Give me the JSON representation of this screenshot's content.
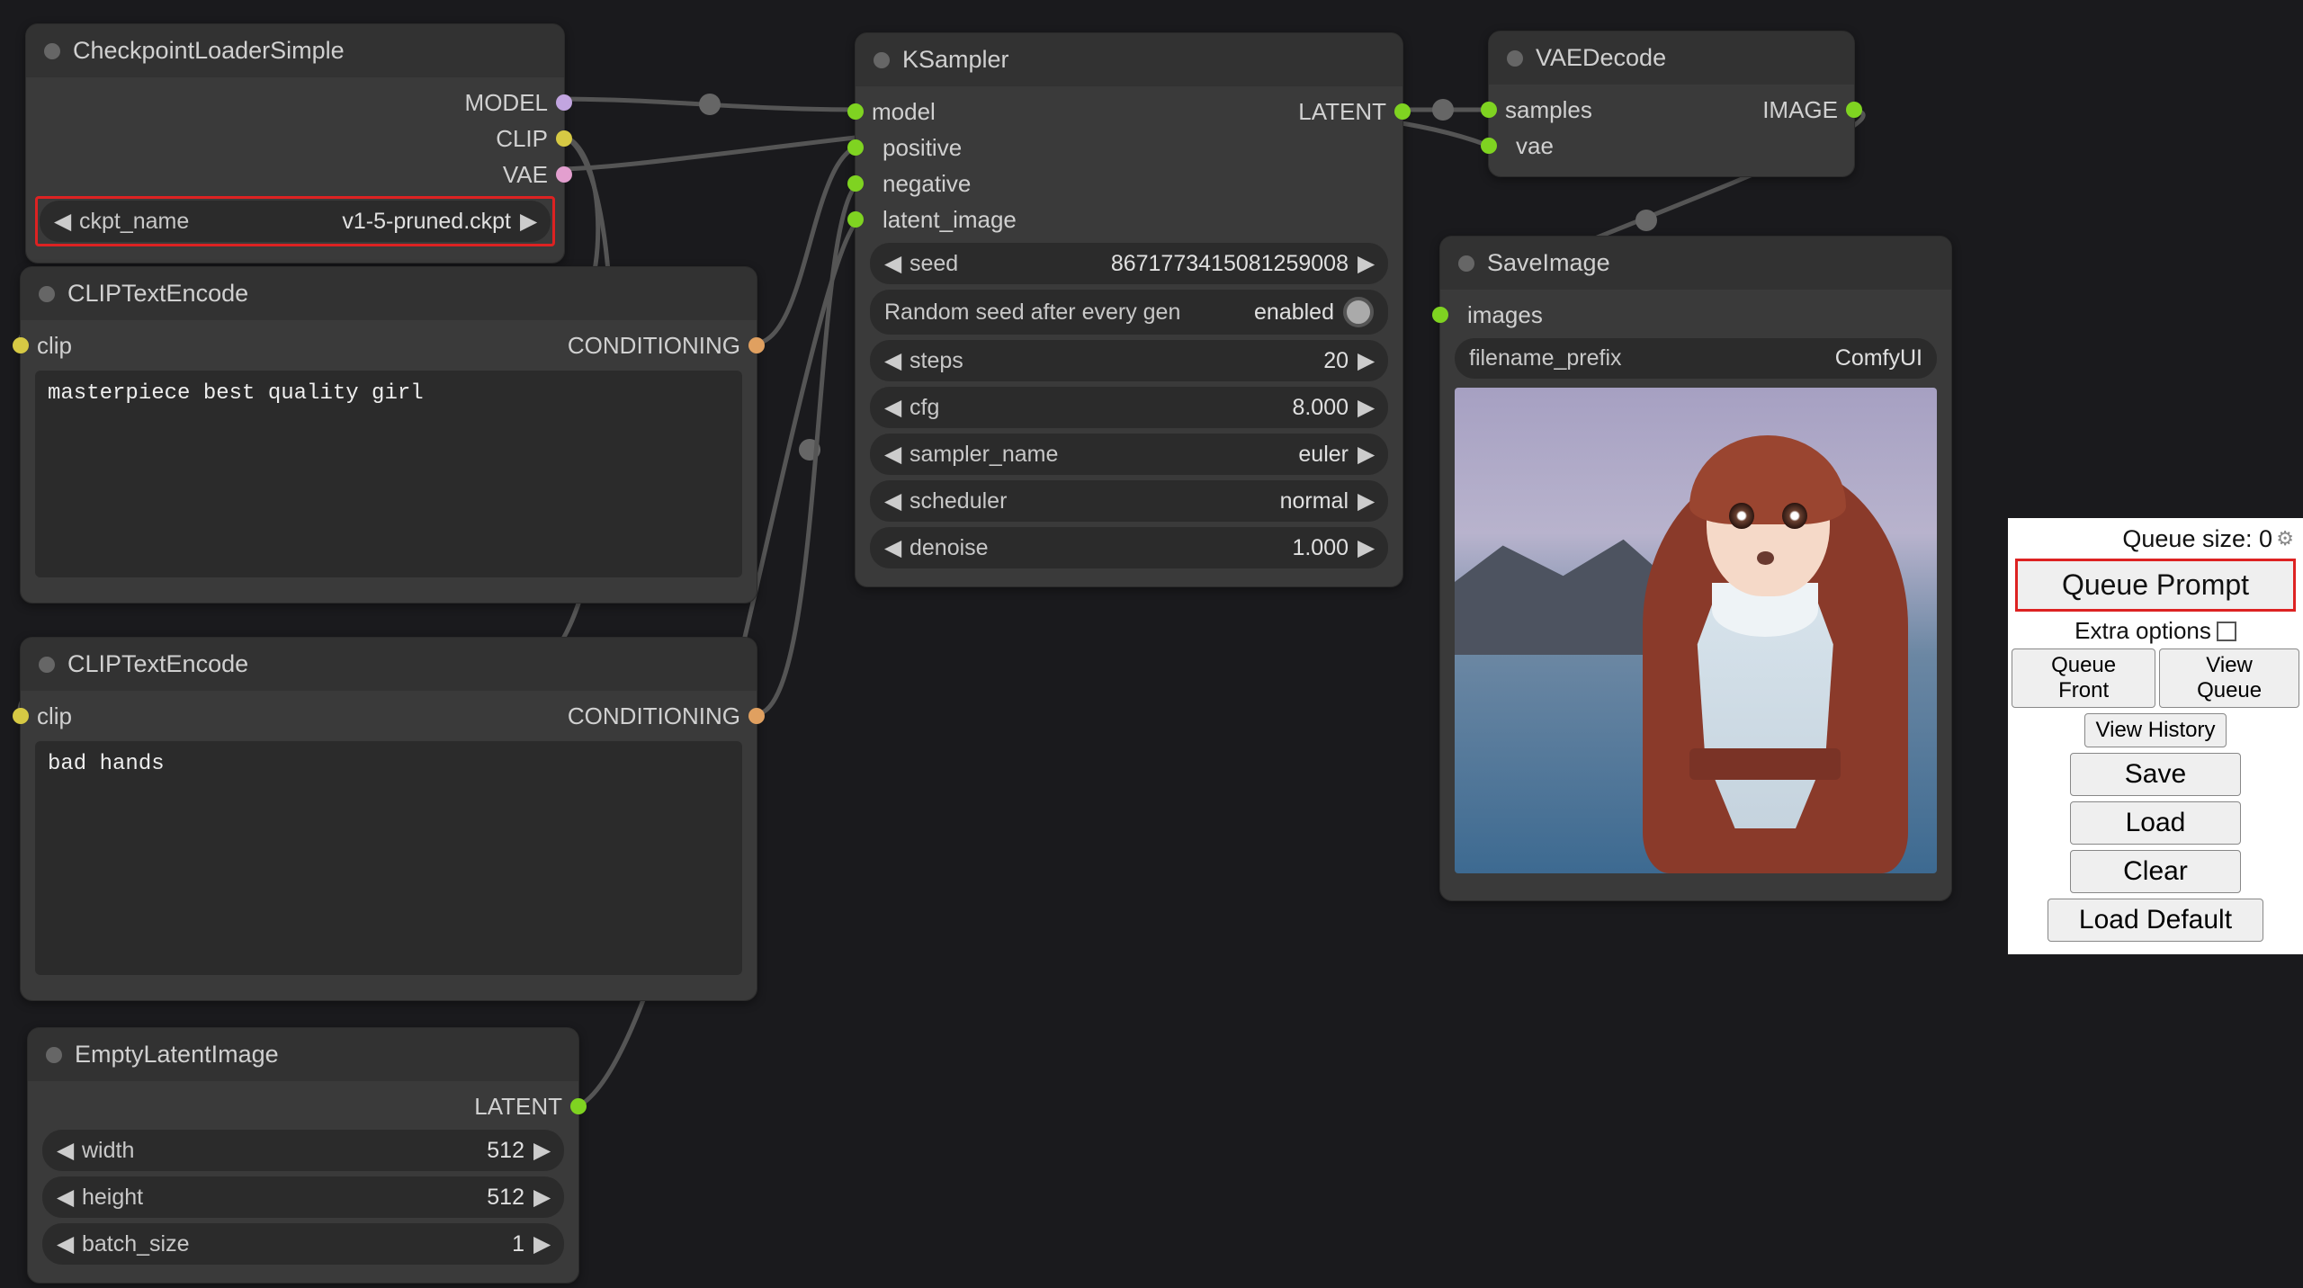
{
  "nodes": {
    "checkpoint": {
      "title": "CheckpointLoaderSimple",
      "outputs": [
        "MODEL",
        "CLIP",
        "VAE"
      ],
      "ckpt_name_label": "ckpt_name",
      "ckpt_name_value": "v1-5-pruned.ckpt"
    },
    "clip_pos": {
      "title": "CLIPTextEncode",
      "input": "clip",
      "output": "CONDITIONING",
      "text": "masterpiece best quality girl"
    },
    "clip_neg": {
      "title": "CLIPTextEncode",
      "input": "clip",
      "output": "CONDITIONING",
      "text": "bad hands"
    },
    "empty_latent": {
      "title": "EmptyLatentImage",
      "output": "LATENT",
      "widgets": {
        "width": {
          "label": "width",
          "value": "512"
        },
        "height": {
          "label": "height",
          "value": "512"
        },
        "batch": {
          "label": "batch_size",
          "value": "1"
        }
      }
    },
    "ksampler": {
      "title": "KSampler",
      "inputs": [
        "model",
        "positive",
        "negative",
        "latent_image"
      ],
      "output": "LATENT",
      "widgets": {
        "seed": {
          "label": "seed",
          "value": "8671773415081259008"
        },
        "random": {
          "label": "Random seed after every gen",
          "value": "enabled"
        },
        "steps": {
          "label": "steps",
          "value": "20"
        },
        "cfg": {
          "label": "cfg",
          "value": "8.000"
        },
        "sampler": {
          "label": "sampler_name",
          "value": "euler"
        },
        "scheduler": {
          "label": "scheduler",
          "value": "normal"
        },
        "denoise": {
          "label": "denoise",
          "value": "1.000"
        }
      }
    },
    "vae_decode": {
      "title": "VAEDecode",
      "inputs": [
        "samples",
        "vae"
      ],
      "output": "IMAGE"
    },
    "save_image": {
      "title": "SaveImage",
      "input": "images",
      "prefix_label": "filename_prefix",
      "prefix_value": "ComfyUI"
    }
  },
  "panel": {
    "queue_size_label": "Queue size: 0",
    "queue_prompt": "Queue Prompt",
    "extra_options": "Extra options",
    "queue_front": "Queue Front",
    "view_queue": "View Queue",
    "view_history": "View History",
    "save": "Save",
    "load": "Load",
    "clear": "Clear",
    "load_default": "Load Default"
  }
}
